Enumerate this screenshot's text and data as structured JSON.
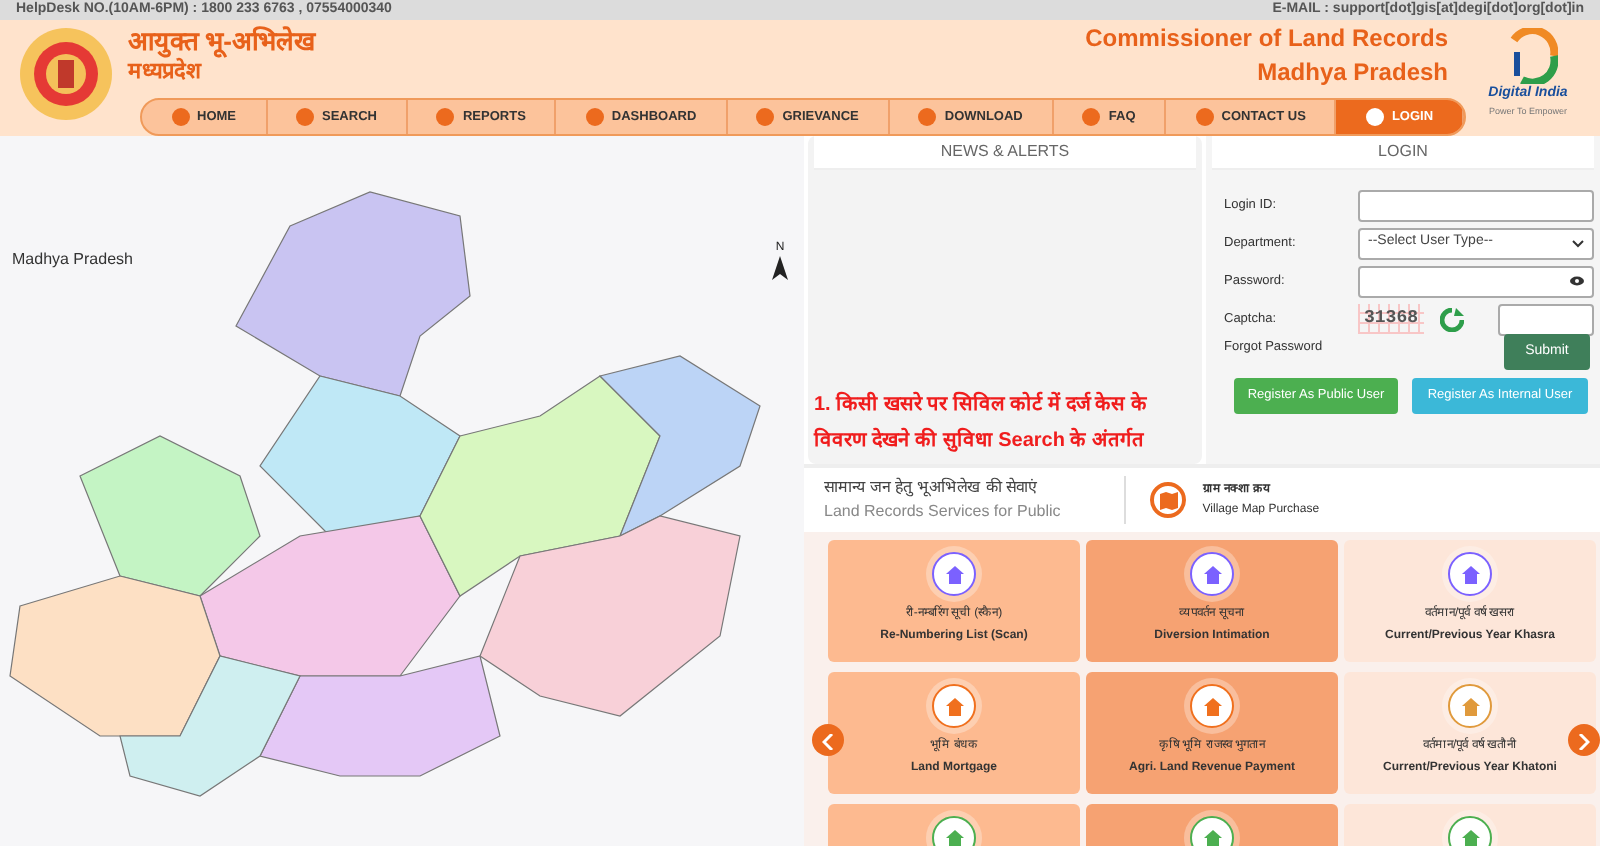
{
  "top_bar": {
    "helpdesk": "HelpDesk NO.(10AM-6PM) : 1800 233 6763 , 07554000340",
    "email": "E-MAIL : support[dot]gis[at]degi[dot]org[dot]in"
  },
  "header": {
    "title_hindi": "आयुक्त भू-अभिलेख",
    "subtitle_hindi": "मध्यप्रदेश",
    "title_english": "Commissioner of Land Records",
    "subtitle_english": "Madhya Pradesh",
    "partner_logo": {
      "name": "Digital India",
      "tagline": "Power To Empower"
    }
  },
  "nav": [
    {
      "label": "HOME",
      "selected": false
    },
    {
      "label": "SEARCH",
      "selected": false
    },
    {
      "label": "REPORTS",
      "selected": false
    },
    {
      "label": "DASHBOARD",
      "selected": false
    },
    {
      "label": "GRIEVANCE",
      "selected": false
    },
    {
      "label": "DOWNLOAD",
      "selected": false
    },
    {
      "label": "FAQ",
      "selected": false
    },
    {
      "label": "CONTACT US",
      "selected": false
    },
    {
      "label": "LOGIN",
      "selected": true
    }
  ],
  "map": {
    "title": "Madhya Pradesh",
    "north_label": "N"
  },
  "news": {
    "heading": "NEWS & ALERTS",
    "items": [
      "1. किसी खसरे पर सिविल कोर्ट में दर्ज केस के विवरण देखने की सुविधा Search के अंतर्गत"
    ]
  },
  "login": {
    "heading": "LOGIN",
    "fields": [
      {
        "label": "Login ID:",
        "kind": "text"
      },
      {
        "label": "Department:",
        "kind": "select",
        "value": "--Select User Type--"
      },
      {
        "label": "Password:",
        "kind": "password"
      },
      {
        "label": "Captcha:",
        "kind": "captcha",
        "captcha": "31368"
      }
    ],
    "forgot": "Forgot Password",
    "submit": "Submit",
    "register_public": "Register As Public User",
    "register_internal": "Register As Internal User"
  },
  "services": {
    "title_hindi": "सामान्य जन हेतु भूअभिलेख की सेवाएं",
    "title_english": "Land Records Services for Public",
    "featured": {
      "hindi": "ग्राम नक्शा क्रय",
      "english": "Village Map Purchase"
    },
    "tiles": [
      {
        "hindi": "री-नम्बरिंग सूची (स्कैन)",
        "english": "Re-Numbering List (Scan)",
        "color": "#fdba90",
        "icon": {
          "color": "#7b61ff"
        }
      },
      {
        "hindi": "व्यपवर्तन सूचना",
        "english": "Diversion Intimation",
        "color": "#f6a272",
        "icon": {
          "color": "#7b61ff"
        }
      },
      {
        "hindi": "वर्तमान/पूर्व वर्ष खसरा",
        "english": "Current/Previous Year Khasra",
        "color": "#fde6d9",
        "icon": {
          "color": "#7b61ff"
        }
      },
      {
        "hindi": "भूमि बंधक",
        "english": "Land Mortgage",
        "color": "#fdba90",
        "icon": {
          "color": "#f0701e"
        }
      },
      {
        "hindi": "कृषि भूमि राजस्व भुगतान",
        "english": "Agri. Land Revenue Payment",
        "color": "#f6a272",
        "icon": {
          "color": "#f0701e"
        }
      },
      {
        "hindi": "वर्तमान/पूर्व वर्ष खतौनी",
        "english": "Current/Previous Year Khatoni",
        "color": "#fde6d9",
        "icon": {
          "color": "#e09a3c"
        }
      },
      {
        "color": "#fdba90",
        "icon": {
          "color": "#4caf50"
        }
      },
      {
        "color": "#f6a272",
        "icon": {
          "color": "#4caf50"
        }
      },
      {
        "color": "#fde6d9",
        "icon": {
          "color": "#4caf50"
        }
      }
    ]
  }
}
